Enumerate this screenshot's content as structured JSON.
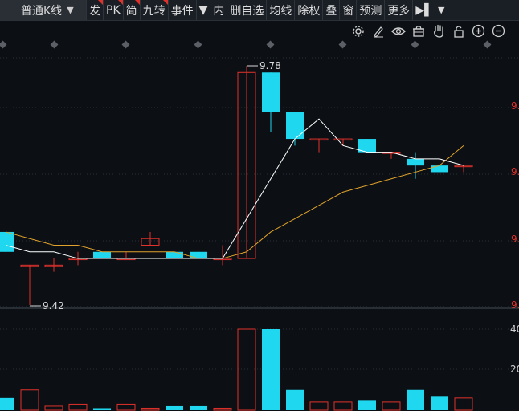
{
  "toolbar": {
    "period_label": "普通K线",
    "items": [
      {
        "label": "发",
        "marked": true
      },
      {
        "label": "PK",
        "marked": true
      },
      {
        "label": "简",
        "marked": true
      },
      {
        "label": "九转",
        "marked": true
      },
      {
        "label": "事件",
        "marked": false
      },
      {
        "label": "▼",
        "marked": false
      },
      {
        "label": "内",
        "marked": false
      },
      {
        "label": "删自选",
        "marked": false
      },
      {
        "label": "均线",
        "marked": false
      },
      {
        "label": "除权",
        "marked": false
      },
      {
        "label": "叠",
        "marked": false
      },
      {
        "label": "窗",
        "marked": false
      },
      {
        "label": "预测",
        "marked": false
      },
      {
        "label": "更多",
        "marked": false
      }
    ],
    "expand_icon": "▶▌",
    "menu_arrow": "▼"
  },
  "chart_tools": [
    "settings-icon",
    "draw-icon",
    "eye-icon",
    "basket-icon",
    "hand-icon",
    "lock-icon",
    "zoom-in-icon",
    "zoom-out-icon"
  ],
  "chart_data": {
    "type": "candlestick",
    "price_axis_labels": [
      "9.",
      "9.",
      "9.",
      "9.",
      "9."
    ],
    "volume_axis_labels": [
      "40",
      "20"
    ],
    "high_annotation": "9.78",
    "low_annotation": "9.42",
    "candles": [
      {
        "open": 9.53,
        "close": 9.5,
        "high": 9.53,
        "low": 9.5,
        "vol": 6
      },
      {
        "open": 9.48,
        "close": 9.48,
        "high": 9.48,
        "low": 9.42,
        "vol": 10
      },
      {
        "open": 9.48,
        "close": 9.48,
        "high": 9.49,
        "low": 9.47,
        "vol": 2
      },
      {
        "open": 9.49,
        "close": 9.49,
        "high": 9.5,
        "low": 9.48,
        "vol": 3
      },
      {
        "open": 9.5,
        "close": 9.49,
        "high": 9.5,
        "low": 9.49,
        "vol": 1
      },
      {
        "open": 9.49,
        "close": 9.49,
        "high": 9.5,
        "low": 9.49,
        "vol": 3
      },
      {
        "open": 9.51,
        "close": 9.52,
        "high": 9.53,
        "low": 9.51,
        "vol": 1
      },
      {
        "open": 9.5,
        "close": 9.49,
        "high": 9.5,
        "low": 9.49,
        "vol": 2
      },
      {
        "open": 9.5,
        "close": 9.49,
        "high": 9.5,
        "low": 9.49,
        "vol": 2
      },
      {
        "open": 9.49,
        "close": 9.49,
        "high": 9.51,
        "low": 9.48,
        "vol": 1
      },
      {
        "open": 9.49,
        "close": 9.77,
        "high": 9.78,
        "low": 9.49,
        "vol": 40
      },
      {
        "open": 9.77,
        "close": 9.71,
        "high": 9.77,
        "low": 9.68,
        "vol": 40
      },
      {
        "open": 9.71,
        "close": 9.67,
        "high": 9.71,
        "low": 9.66,
        "vol": 10
      },
      {
        "open": 9.67,
        "close": 9.67,
        "high": 9.67,
        "low": 9.65,
        "vol": 4
      },
      {
        "open": 9.67,
        "close": 9.67,
        "high": 9.67,
        "low": 9.66,
        "vol": 4
      },
      {
        "open": 9.67,
        "close": 9.65,
        "high": 9.67,
        "low": 9.65,
        "vol": 5
      },
      {
        "open": 9.65,
        "close": 9.65,
        "high": 9.65,
        "low": 9.64,
        "vol": 4
      },
      {
        "open": 9.64,
        "close": 9.63,
        "high": 9.65,
        "low": 9.61,
        "vol": 10
      },
      {
        "open": 9.63,
        "close": 9.62,
        "high": 9.63,
        "low": 9.62,
        "vol": 7
      },
      {
        "open": 9.63,
        "close": 9.63,
        "high": 9.63,
        "low": 9.62,
        "vol": 6
      }
    ],
    "ma_short": [
      9.51,
      9.5,
      9.5,
      9.49,
      9.49,
      9.49,
      9.49,
      9.49,
      9.49,
      9.49,
      9.55,
      9.61,
      9.67,
      9.7,
      9.66,
      9.65,
      9.65,
      9.64,
      9.64,
      9.63
    ],
    "ma_long": [
      9.53,
      9.52,
      9.51,
      9.51,
      9.5,
      9.5,
      9.5,
      9.5,
      9.49,
      9.49,
      9.5,
      9.53,
      9.55,
      9.57,
      9.59,
      9.6,
      9.61,
      9.62,
      9.63,
      9.66
    ]
  },
  "colors": {
    "up": "#e0312b",
    "down": "#1fd8f0",
    "ma_short": "#ffffff",
    "ma_long": "#e0a22b",
    "background": "#0c1015",
    "grid": "#2a2f36"
  }
}
